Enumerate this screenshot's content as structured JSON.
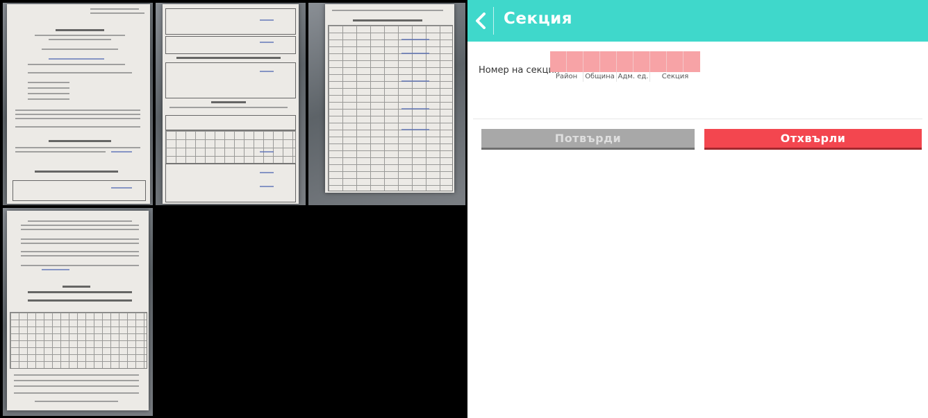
{
  "header": {
    "title": "Секция",
    "back_icon": "chevron-left-icon",
    "color": "#3fd8cb"
  },
  "section_code": {
    "label": "Номер на секция",
    "cell_count": 9,
    "cell_color": "#f7a3a6",
    "segments": [
      {
        "label": "Район",
        "cells": 2
      },
      {
        "label": "Община",
        "cells": 2
      },
      {
        "label": "Адм. ед.",
        "cells": 2
      },
      {
        "label": "Секция",
        "cells": 3
      }
    ]
  },
  "buttons": {
    "confirm_label": "Потвърди",
    "reject_label": "Отхвърли",
    "confirm_color": "#a8a8a8",
    "reject_color": "#f3464f"
  },
  "photos": {
    "count": 4
  }
}
